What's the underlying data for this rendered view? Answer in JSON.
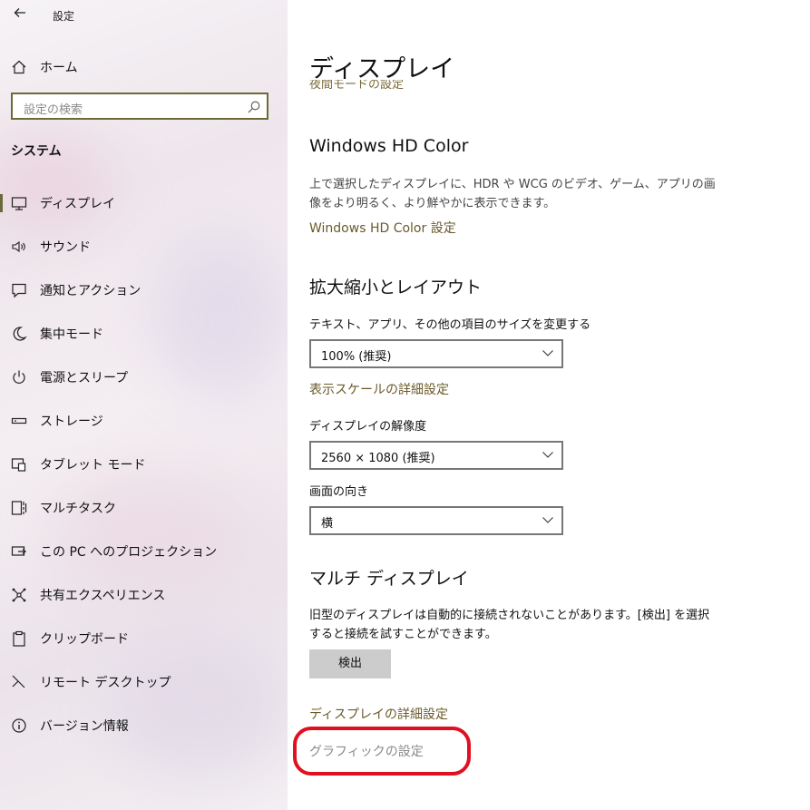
{
  "window": {
    "app_title": "設定",
    "back_icon": "back-arrow-icon"
  },
  "sidebar": {
    "home_label": "ホーム",
    "search_placeholder": "設定の検索",
    "section_title": "システム",
    "items": [
      {
        "label": "ディスプレイ",
        "icon": "display-icon",
        "active": true
      },
      {
        "label": "サウンド",
        "icon": "speaker-icon"
      },
      {
        "label": "通知とアクション",
        "icon": "notification-icon"
      },
      {
        "label": "集中モード",
        "icon": "moon-icon"
      },
      {
        "label": "電源とスリープ",
        "icon": "power-icon"
      },
      {
        "label": "ストレージ",
        "icon": "storage-icon"
      },
      {
        "label": "タブレット モード",
        "icon": "tablet-icon"
      },
      {
        "label": "マルチタスク",
        "icon": "multitask-icon"
      },
      {
        "label": "この PC へのプロジェクション",
        "icon": "projection-icon"
      },
      {
        "label": "共有エクスペリエンス",
        "icon": "share-icon"
      },
      {
        "label": "クリップボード",
        "icon": "clipboard-icon"
      },
      {
        "label": "リモート デスクトップ",
        "icon": "remote-desktop-icon"
      },
      {
        "label": "バージョン情報",
        "icon": "info-icon"
      }
    ]
  },
  "main": {
    "page_title": "ディスプレイ",
    "clipped_link": "夜間モードの設定",
    "hdr": {
      "heading": "Windows HD Color",
      "description": "上で選択したディスプレイに、HDR や WCG のビデオ、ゲーム、アプリの画像をより明るく、より鮮やかに表示できます。",
      "link": "Windows HD Color 設定"
    },
    "scale": {
      "heading": "拡大縮小とレイアウト",
      "size_label": "テキスト、アプリ、その他の項目のサイズを変更する",
      "size_value": "100% (推奨)",
      "advanced_link": "表示スケールの詳細設定",
      "resolution_label": "ディスプレイの解像度",
      "resolution_value": "2560 × 1080 (推奨)",
      "orientation_label": "画面の向き",
      "orientation_value": "横"
    },
    "multi": {
      "heading": "マルチ ディスプレイ",
      "description": "旧型のディスプレイは自動的に接続されないことがあります。[検出] を選択すると接続を試すことができます。",
      "detect_button": "検出",
      "advanced_link": "ディスプレイの詳細設定",
      "graphics_link": "グラフィックの設定"
    }
  },
  "colors": {
    "accent": "#6b5a2a",
    "highlight": "#e01020"
  }
}
